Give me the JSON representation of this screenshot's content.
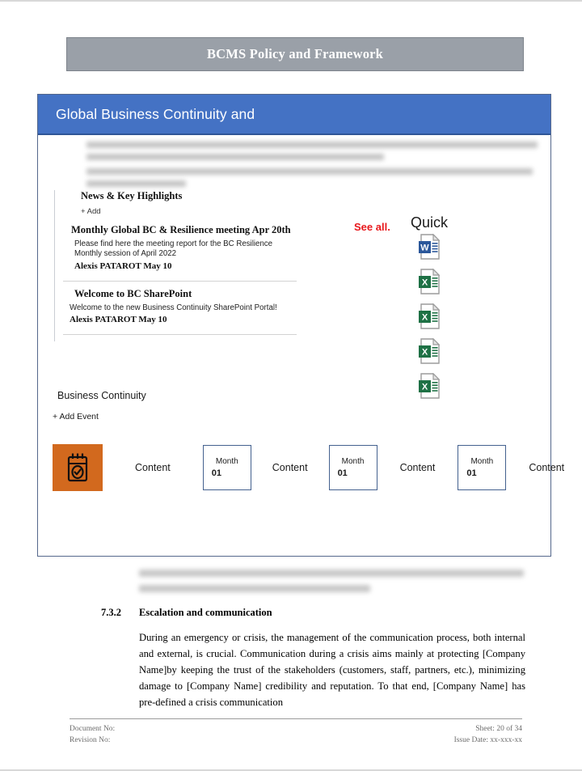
{
  "document": {
    "title": "BCMS Policy and Framework"
  },
  "sharepoint": {
    "header_title": "Global  Business Continuity and",
    "news": {
      "heading": "News & Key Highlights",
      "add_label": "+ Add",
      "see_all_label": "See all.",
      "items": [
        {
          "title": "Monthly Global BC & Resilience meeting Apr 20th",
          "body": "Please find here the meeting report for the BC Resilience Monthly session of April 2022",
          "author": "Alexis PATAROT May 10"
        },
        {
          "title": "Welcome to BC SharePoint",
          "body": "Welcome to the new Business Continuity SharePoint Portal!",
          "author": "Alexis PATAROT May 10"
        }
      ]
    },
    "quick": {
      "label": "Quick",
      "files": [
        {
          "icon": "word-file-icon",
          "type": "word"
        },
        {
          "icon": "excel-file-icon",
          "type": "excel"
        },
        {
          "icon": "excel-file-icon",
          "type": "excel"
        },
        {
          "icon": "excel-file-icon",
          "type": "excel"
        },
        {
          "icon": "excel-file-icon",
          "type": "excel"
        }
      ]
    },
    "events": {
      "heading": "Business Continuity",
      "add_label": "+ Add Event",
      "calendar_icon": "calendar-check-icon",
      "tile_color": "#d2691e",
      "entries": [
        {
          "content_label": "Content"
        },
        {
          "month_label": "Month",
          "day": "01",
          "content_label": "Content"
        },
        {
          "month_label": "Month",
          "day": "01",
          "content_label": "Content"
        },
        {
          "month_label": "Month",
          "day": "01",
          "content_label": "Content"
        }
      ]
    },
    "accent_color": "#4472c4"
  },
  "section": {
    "number": "7.3.2",
    "title": "Escalation and communication",
    "paragraph": "During an emergency or crisis, the management of the communication process, both internal and external, is crucial. Communication during a crisis aims mainly at protecting [Company Name]by keeping the trust of the stakeholders (customers, staff, partners, etc.), minimizing damage to [Company Name] credibility and reputation. To that end, [Company Name] has pre-defined a crisis communication"
  },
  "footer": {
    "document_no": "Document No:",
    "revision_no": "Revision No:",
    "sheet": "Sheet: 20 of 34",
    "issue_date": "Issue Date: xx-xxx-xx"
  }
}
